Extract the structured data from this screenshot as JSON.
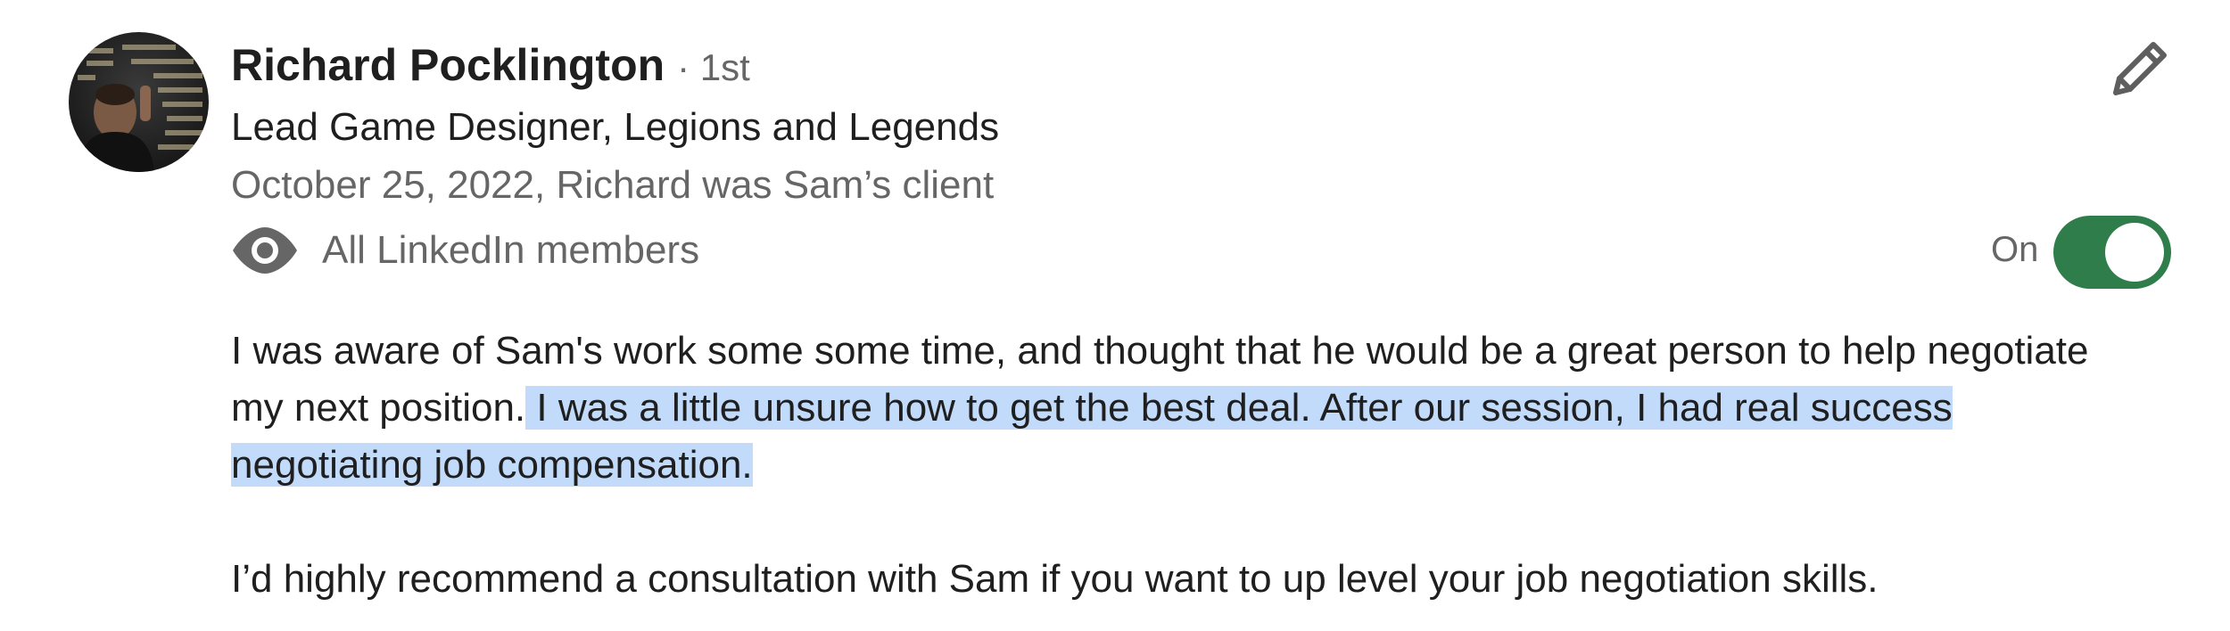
{
  "recommendation": {
    "author": {
      "name": "Richard Pocklington",
      "degree": "· 1st",
      "headline": "Lead Game Designer, Legions and Legends",
      "relationship": "October 25, 2022, Richard was Sam’s client"
    },
    "visibility": {
      "label": "All LinkedIn members",
      "toggle_label": "On",
      "toggle_on": true,
      "toggle_color": "#2e7d4a"
    },
    "body": {
      "p1_plain": "I was aware of Sam's work some some time, and thought that he would be a great person to help negotiate my next position.",
      "p1_selected": " I was a little unsure how to get the best deal. After our session, I had real success negotiating job compensation. ",
      "p2": "I’d highly recommend a consultation with Sam if you want to up level your job negotiation skills."
    },
    "selection_color": "#c2dbfa"
  },
  "icons": {
    "edit": "pencil-icon",
    "visibility": "eye-icon"
  }
}
